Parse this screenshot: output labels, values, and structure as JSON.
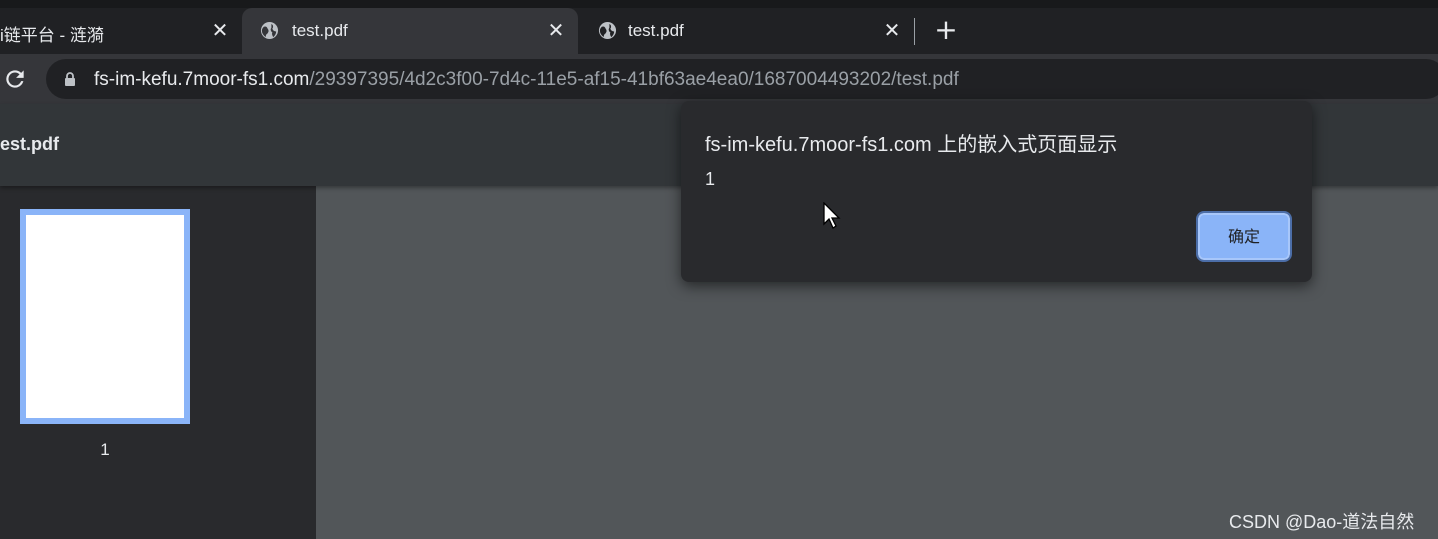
{
  "tabs": [
    {
      "title": "i链平台 - 涟漪",
      "close": "✕",
      "icon": "none"
    },
    {
      "title": "test.pdf",
      "close": "✕",
      "icon": "globe-icon",
      "active": true
    },
    {
      "title": "test.pdf",
      "close": "✕",
      "icon": "globe-icon"
    }
  ],
  "new_tab": "+",
  "address_bar": {
    "host": "fs-im-kefu.7moor-fs1.com",
    "path": "/29397395/4d2c3f00-7d4c-11e5-af15-41bf63ae4ea0/1687004493202/test.pdf",
    "lock_icon": "lock-icon",
    "reload_icon": "reload-icon"
  },
  "pdf_viewer": {
    "title": "test.pdf",
    "thumbnail_page": "1"
  },
  "dialog": {
    "title": "fs-im-kefu.7moor-fs1.com 上的嵌入式页面显示",
    "message": "1",
    "ok_label": "确定"
  },
  "watermark": "CSDN @Dao-道法自然",
  "colors": {
    "accent": "#8ab4f8",
    "frame": "#202124",
    "toolbar": "#35363a",
    "viewer_bg": "#525659"
  }
}
